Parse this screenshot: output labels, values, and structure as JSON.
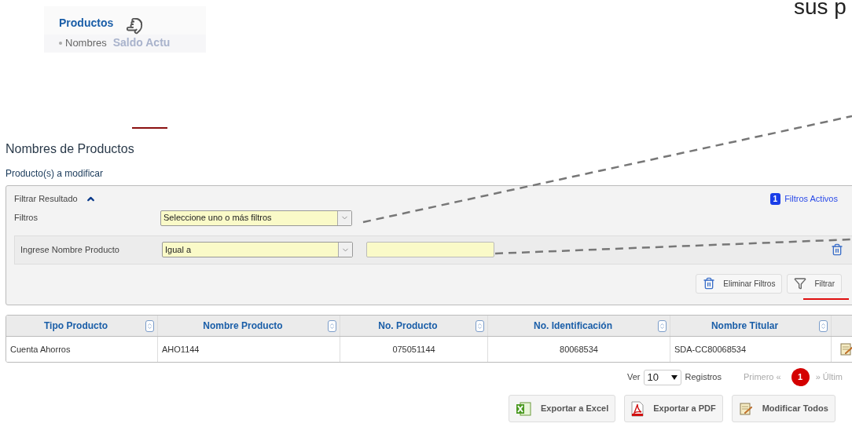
{
  "menu": {
    "title": "Productos",
    "item": "Nombres",
    "faded_item": "Saldo Actu"
  },
  "caption": "sus p",
  "page": {
    "title": "Nombres de Productos",
    "subtitle": "Producto(s) a modificar"
  },
  "filter_panel": {
    "title": "Filtrar Resultado",
    "expanded": true,
    "active_count": "1",
    "active_label": "Filtros Activos",
    "filters_label": "Filtros",
    "filters_select": {
      "placeholder": "Seleccione uno o más filtros"
    },
    "condition": {
      "label": "Ingrese Nombre Producto",
      "operator": "Igual a"
    },
    "buttons": [
      {
        "label": "Eliminar Filtros",
        "kind": "clear"
      },
      {
        "label": "Filtrar",
        "kind": "filter"
      }
    ]
  },
  "table": {
    "columns": [
      "Tipo Producto",
      "Nombre Producto",
      "No. Producto",
      "No. Identificación",
      "Nombre Titular"
    ],
    "rows": [
      [
        "Cuenta Ahorros",
        "AHO1144",
        "075051144",
        "80068534",
        "SDA-CC80068534"
      ]
    ]
  },
  "pagination": {
    "show_label": "Ver",
    "page_size": "10",
    "records_label": "Registros",
    "first": "Primero «",
    "pages": [
      {
        "label": "1",
        "selected": true
      }
    ],
    "last": "» Últim"
  },
  "actions": [
    {
      "label": "Exportar a Excel",
      "kind": "excel"
    },
    {
      "label": "Exportar a PDF",
      "kind": "pdf"
    },
    {
      "label": "Modificar Todos",
      "kind": "edit"
    }
  ]
}
